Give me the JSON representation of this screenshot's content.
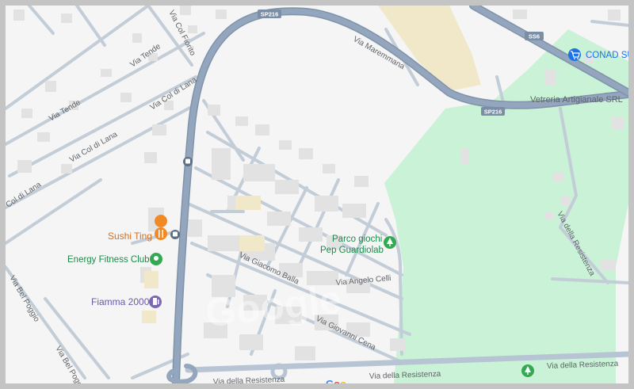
{
  "map": {
    "colors": {
      "background": "#f5f5f5",
      "park": "#c9f2d7",
      "major_road": "#8fa2b8",
      "minor_road": "#c3cdd8",
      "building": "#e2e2e2",
      "food_pin": "#f08a24",
      "park_pin": "#34a853",
      "purple_pin": "#7b68b5",
      "shop_pin": "#1a73e8",
      "frame": "#c4c4c4"
    },
    "shields": {
      "sp216_top": "SP216",
      "sp216_right": "SP216",
      "ss6": "SS6"
    },
    "streets": {
      "via_col_fiorito": "Via Col Fiorito",
      "via_tende_1": "Via Tende",
      "via_tende_2": "Via Tende",
      "via_col_di_lana_1": "Via Col di Lana",
      "via_col_di_lana_2": "Via Col di Lana",
      "via_col_di_lana_3": "Col di Lana",
      "via_maremmana": "Via Maremmana",
      "via_bel_poggio_1": "Via Bel Poggio",
      "via_bel_poggio_2": "Via Bel Pogg",
      "via_giacomo_balla": "Via Giacomo Balla",
      "via_angelo_celli": "Via Angelo Celli",
      "via_giovanni_cena": "Via Giovanni Cena",
      "via_della_resistenza_bottom": "Via della Resistenza",
      "via_della_resistenza_right": "Via della Resistenza",
      "via_della_resistenza_east": "Via della Resistenza",
      "via_della_resistenza_partial": "Via della Resistenza"
    },
    "pois": {
      "sushi_ting": {
        "label": "Sushi Ting",
        "icon": "fork-knife-icon"
      },
      "energy_fitness": {
        "label": "Energy Fitness Club",
        "icon": "park-pin-icon"
      },
      "fiamma_2000": {
        "label": "Fiamma 2000",
        "icon": "gas-station-icon"
      },
      "parco_giochi": {
        "label_line1": "Parco giochi",
        "label_line2": "Pep Guardiolab",
        "icon": "tree-icon"
      },
      "conad": {
        "label": "CONAD SU",
        "icon": "shopping-cart-icon"
      },
      "vetreria": {
        "label": "Vetreria Artigianale SRL"
      }
    },
    "watermark": "Google"
  }
}
